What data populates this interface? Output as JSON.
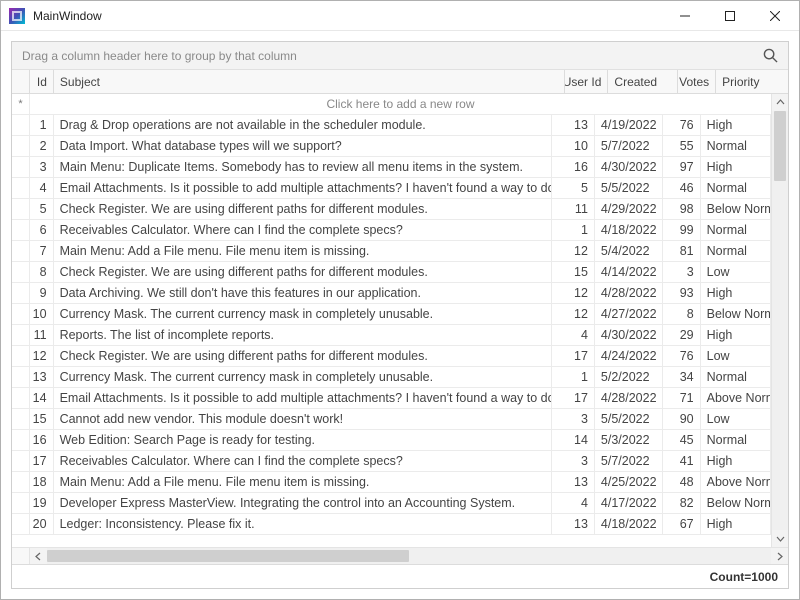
{
  "window": {
    "title": "MainWindow"
  },
  "group_panel_text": "Drag a column header here to group by that column",
  "columns": {
    "id": "Id",
    "subject": "Subject",
    "user_id": "User Id",
    "created": "Created",
    "votes": "Votes",
    "priority": "Priority"
  },
  "new_row_indicator": "*",
  "new_row_text": "Click here to add a new row",
  "rows": [
    {
      "id": 1,
      "subject": "Drag & Drop operations are not available in the scheduler module.",
      "user_id": 13,
      "created": "4/19/2022",
      "votes": 76,
      "priority": "High"
    },
    {
      "id": 2,
      "subject": "Data Import. What database types will we support?",
      "user_id": 10,
      "created": "5/7/2022",
      "votes": 55,
      "priority": "Normal"
    },
    {
      "id": 3,
      "subject": "Main Menu: Duplicate Items. Somebody has to review all menu items in the system.",
      "user_id": 16,
      "created": "4/30/2022",
      "votes": 97,
      "priority": "High"
    },
    {
      "id": 4,
      "subject": "Email Attachments. Is it possible to add multiple attachments? I haven't found a way to do this.",
      "user_id": 5,
      "created": "5/5/2022",
      "votes": 46,
      "priority": "Normal"
    },
    {
      "id": 5,
      "subject": "Check Register. We are using different paths for different modules.",
      "user_id": 11,
      "created": "4/29/2022",
      "votes": 98,
      "priority": "Below Normal"
    },
    {
      "id": 6,
      "subject": "Receivables Calculator. Where can I find the complete specs?",
      "user_id": 1,
      "created": "4/18/2022",
      "votes": 99,
      "priority": "Normal"
    },
    {
      "id": 7,
      "subject": "Main Menu: Add a File menu. File menu item is missing.",
      "user_id": 12,
      "created": "5/4/2022",
      "votes": 81,
      "priority": "Normal"
    },
    {
      "id": 8,
      "subject": "Check Register. We are using different paths for different modules.",
      "user_id": 15,
      "created": "4/14/2022",
      "votes": 3,
      "priority": "Low"
    },
    {
      "id": 9,
      "subject": "Data Archiving. We still don't have this features in our application.",
      "user_id": 12,
      "created": "4/28/2022",
      "votes": 93,
      "priority": "High"
    },
    {
      "id": 10,
      "subject": "Currency Mask. The current currency mask in completely unusable.",
      "user_id": 12,
      "created": "4/27/2022",
      "votes": 8,
      "priority": "Below Normal"
    },
    {
      "id": 11,
      "subject": "Reports. The list of incomplete reports.",
      "user_id": 4,
      "created": "4/30/2022",
      "votes": 29,
      "priority": "High"
    },
    {
      "id": 12,
      "subject": "Check Register. We are using different paths for different modules.",
      "user_id": 17,
      "created": "4/24/2022",
      "votes": 76,
      "priority": "Low"
    },
    {
      "id": 13,
      "subject": "Currency Mask. The current currency mask in completely unusable.",
      "user_id": 1,
      "created": "5/2/2022",
      "votes": 34,
      "priority": "Normal"
    },
    {
      "id": 14,
      "subject": "Email Attachments. Is it possible to add multiple attachments? I haven't found a way to do this.",
      "user_id": 17,
      "created": "4/28/2022",
      "votes": 71,
      "priority": "Above Normal"
    },
    {
      "id": 15,
      "subject": "Cannot add new vendor. This module doesn't work!",
      "user_id": 3,
      "created": "5/5/2022",
      "votes": 90,
      "priority": "Low"
    },
    {
      "id": 16,
      "subject": "Web Edition: Search Page is ready for testing.",
      "user_id": 14,
      "created": "5/3/2022",
      "votes": 45,
      "priority": "Normal"
    },
    {
      "id": 17,
      "subject": "Receivables Calculator. Where can I find the complete specs?",
      "user_id": 3,
      "created": "5/7/2022",
      "votes": 41,
      "priority": "High"
    },
    {
      "id": 18,
      "subject": "Main Menu: Add a File menu. File menu item is missing.",
      "user_id": 13,
      "created": "4/25/2022",
      "votes": 48,
      "priority": "Above Normal"
    },
    {
      "id": 19,
      "subject": "Developer Express MasterView. Integrating the control into an Accounting System.",
      "user_id": 4,
      "created": "4/17/2022",
      "votes": 82,
      "priority": "Below Normal"
    },
    {
      "id": 20,
      "subject": "Ledger: Inconsistency. Please fix it.",
      "user_id": 13,
      "created": "4/18/2022",
      "votes": 67,
      "priority": "High"
    }
  ],
  "footer": {
    "count_label": "Count=1000"
  }
}
